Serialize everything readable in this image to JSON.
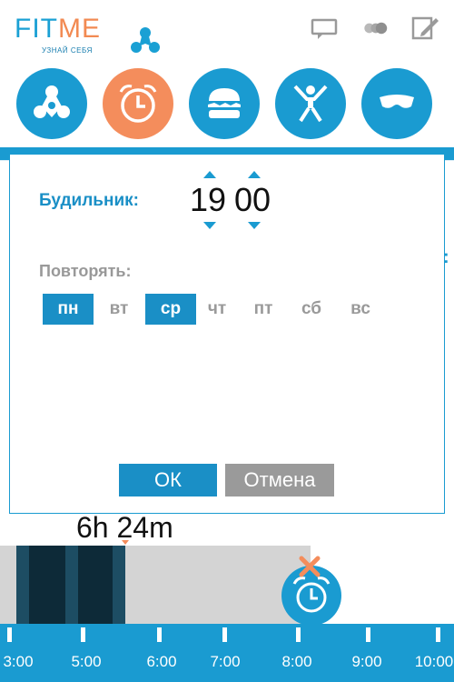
{
  "header": {
    "logo_fit": "FIT",
    "logo_me": "ME",
    "tagline": "УЗНАЙ СЕБЯ",
    "icons": [
      "chat-icon",
      "toggle-icon",
      "edit-icon"
    ]
  },
  "categories": [
    {
      "name": "activity-icon",
      "active": false
    },
    {
      "name": "alarm-clock-icon",
      "active": true
    },
    {
      "name": "burger-icon",
      "active": false
    },
    {
      "name": "person-jumping-icon",
      "active": false
    },
    {
      "name": "sleep-mask-icon",
      "active": false
    }
  ],
  "side_colon": ":",
  "dialog": {
    "alarm_label": "Будильник:",
    "hours": "19",
    "minutes": "00",
    "repeat_label": "Повторять:",
    "days": [
      {
        "label": "пн",
        "selected": true
      },
      {
        "label": "вт",
        "selected": false
      },
      {
        "label": "ср",
        "selected": true
      },
      {
        "label": "чт",
        "selected": false
      },
      {
        "label": "пт",
        "selected": false
      },
      {
        "label": "сб",
        "selected": false
      },
      {
        "label": "вс",
        "selected": false
      }
    ],
    "ok_label": "ОК",
    "cancel_label": "Отмена"
  },
  "sleep": {
    "duration": "6h 24m",
    "axis_labels": [
      "3:00",
      "5:00",
      "6:00",
      "7:00",
      "8:00",
      "9:00",
      "10:00"
    ]
  },
  "colors": {
    "primary": "#1a9bd1",
    "accent": "#f48d5c",
    "deep_sleep": "#0d2a38",
    "light_sleep": "#1d4d63",
    "awake": "#d4d4d4"
  }
}
